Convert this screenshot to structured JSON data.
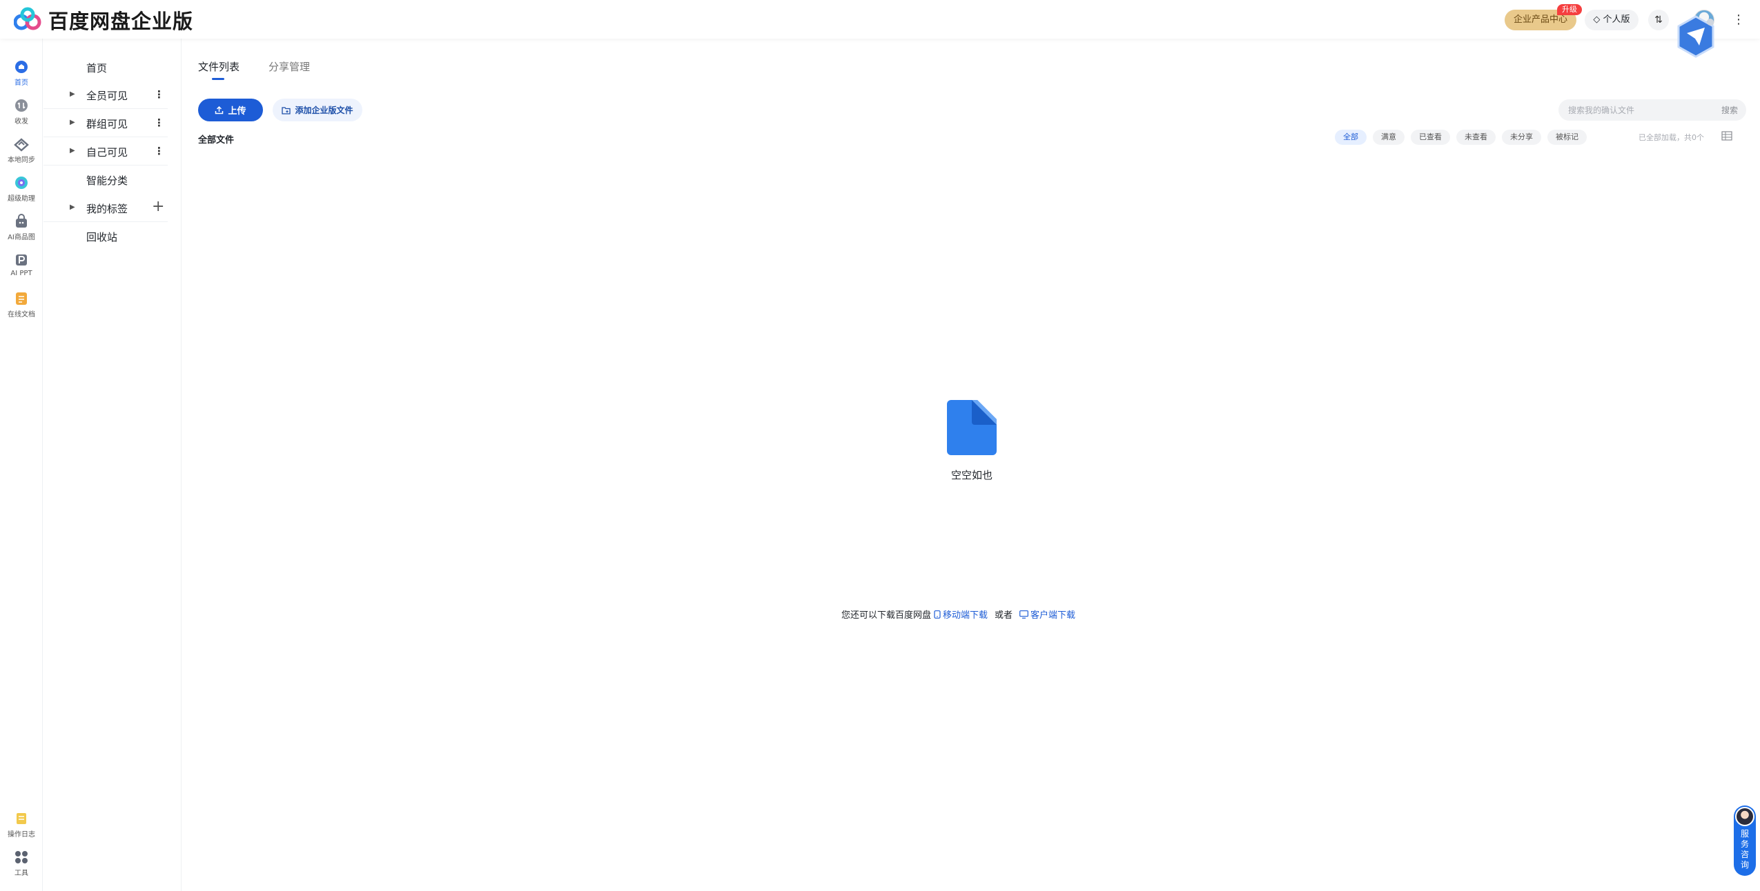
{
  "header": {
    "brand": "百度网盘企业版",
    "enterprise_center": "企业产品中心",
    "upgrade_badge": "升级",
    "personal_edition": "◇ 个人版",
    "sort_icon": "⇅",
    "more_icon": "⋮"
  },
  "rail": [
    {
      "label": "首页",
      "icon": "home-icon",
      "color": "#2b6de5"
    },
    {
      "label": "收发",
      "icon": "transfer-icon",
      "color": "#8a8f99"
    },
    {
      "label": "本地同步",
      "icon": "sync-icon",
      "color": "#6b7280"
    },
    {
      "label": "超级助理",
      "icon": "assistant-icon",
      "color": "#39c5d8"
    },
    {
      "label": "AI商品图",
      "icon": "bag-icon",
      "color": "#6b7280"
    },
    {
      "label": "AI PPT",
      "icon": "ppt-icon",
      "color": "#6b7280"
    },
    {
      "label": "在线文档",
      "icon": "doc-icon",
      "color": "#f2a93b"
    },
    {
      "label": "操作日志",
      "icon": "log-icon",
      "color": "#f2c94c"
    },
    {
      "label": "工具",
      "icon": "tools-icon",
      "color": "#5b6270"
    }
  ],
  "tree": {
    "items": [
      {
        "label": "首页"
      },
      {
        "label": "全员可见"
      },
      {
        "label": "群组可见"
      },
      {
        "label": "自己可见"
      },
      {
        "label": "智能分类"
      },
      {
        "label": "我的标签"
      },
      {
        "label": "回收站"
      }
    ],
    "caret": "▶",
    "kebab": "⋮",
    "plus": "+"
  },
  "main": {
    "tabs": [
      {
        "label": "文件列表"
      },
      {
        "label": "分享管理"
      }
    ],
    "upload_label": "上传",
    "add_label": "添加企业版文件",
    "search_placeholder": "搜索我的确认文件",
    "search_label": "搜索",
    "all_files_title": "全部文件",
    "filters": [
      "全部",
      "满意",
      "已查看",
      "未查看",
      "未分享",
      "被标记"
    ],
    "load_status": "已全部加载，共0个",
    "empty_text": "空空如也",
    "download_prefix": "您还可以下载百度网盘",
    "mobile_download": "移动端下载",
    "or": "或者",
    "desktop_download": "客户端下载"
  },
  "service": {
    "label": "服务咨询"
  },
  "colors": {
    "accent": "#1d5cd6",
    "gold": "#e9c98b",
    "badge": "#f53f3f"
  }
}
